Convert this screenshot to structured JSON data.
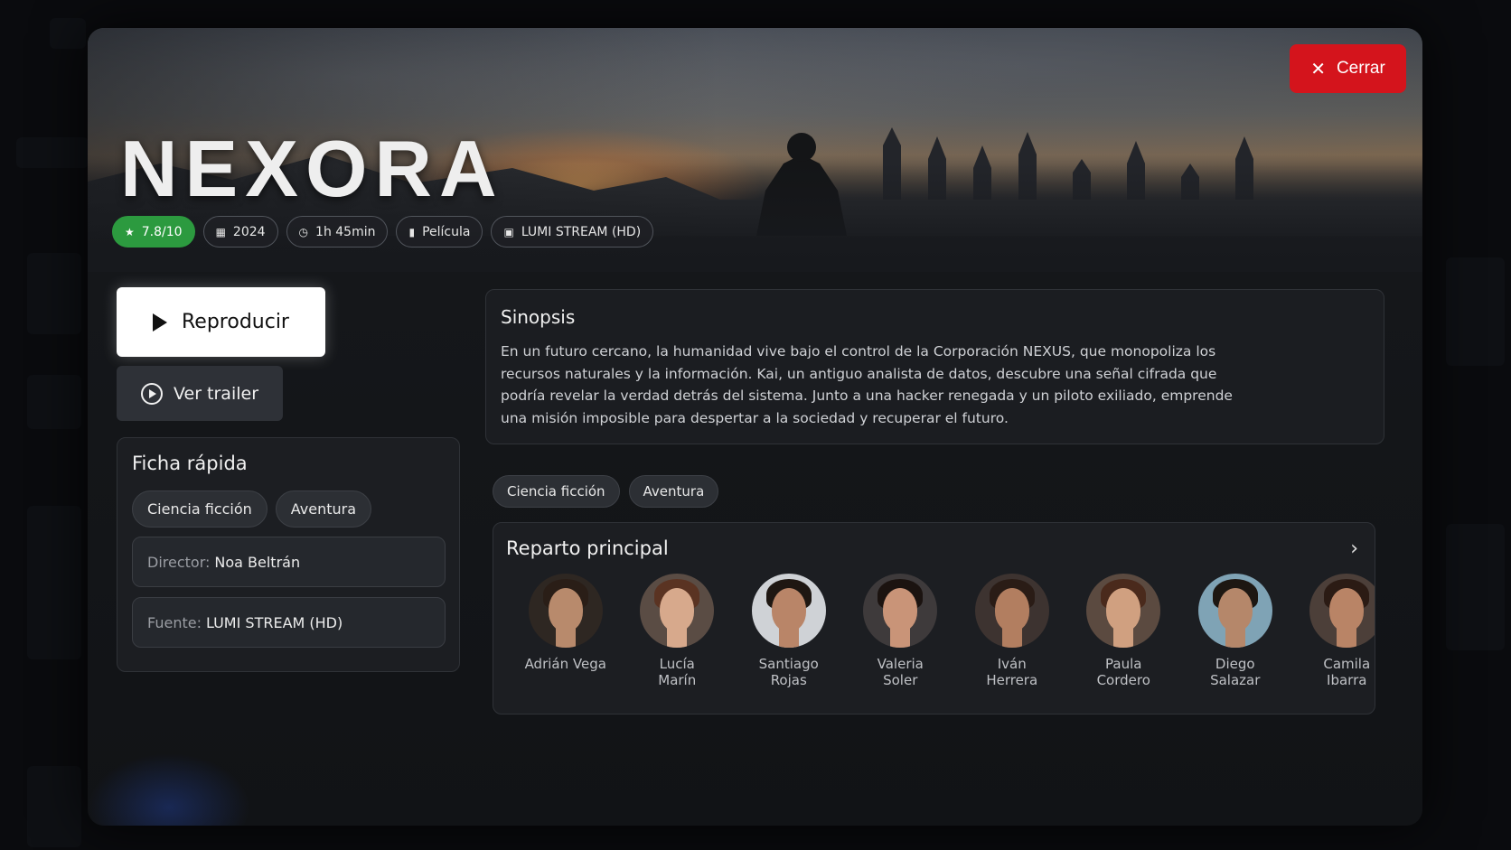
{
  "modal": {
    "close_label": "Cerrar",
    "title": "NEXORA",
    "meta": {
      "rating": "7.8/10",
      "year": "2024",
      "duration": "1h 45min",
      "type": "Película",
      "source": "LUMI STREAM (HD)"
    },
    "play_label": "Reproducir",
    "trailer_label": "Ver trailer",
    "quick_sheet": {
      "title": "Ficha rápida",
      "genres": [
        "Ciencia ficción",
        "Aventura"
      ],
      "director_label": "Director:",
      "director_value": "Noa Beltrán",
      "source_label": "Fuente:",
      "source_value": "LUMI STREAM (HD)"
    },
    "synopsis": {
      "title": "Sinopsis",
      "text": "En un futuro cercano, la humanidad vive bajo el control de la Corporación NEXUS, que monopoliza los recursos naturales y la información. Kai, un antiguo analista de datos, descubre una señal cifrada que podría revelar la verdad detrás del sistema. Junto a una hacker renegada y un piloto exiliado, emprende una misión imposible para despertar a la sociedad y recuperar el futuro."
    },
    "genres": [
      "Ciencia ficción",
      "Aventura"
    ],
    "cast": {
      "title": "Reparto principal",
      "members": [
        {
          "first": "Adrián Vega",
          "last": ""
        },
        {
          "first": "Lucía",
          "last": "Marín"
        },
        {
          "first": "Santiago",
          "last": "Rojas"
        },
        {
          "first": "Valeria",
          "last": "Soler"
        },
        {
          "first": "Iván",
          "last": "Herrera"
        },
        {
          "first": "Paula",
          "last": "Cordero"
        },
        {
          "first": "Diego",
          "last": "Salazar"
        },
        {
          "first": "Camila",
          "last": "Ibarra"
        }
      ]
    }
  },
  "colors": {
    "accent_close": "#d4141c",
    "rating_badge": "#2c9a3f"
  },
  "icons": {
    "close": "close-icon",
    "rating": "star-icon",
    "year": "calendar-icon",
    "duration": "clock-icon",
    "type": "film-icon",
    "source": "stream-icon",
    "play": "play-icon",
    "trailer": "play-circle-icon",
    "cast_next": "chevron-right-icon"
  }
}
